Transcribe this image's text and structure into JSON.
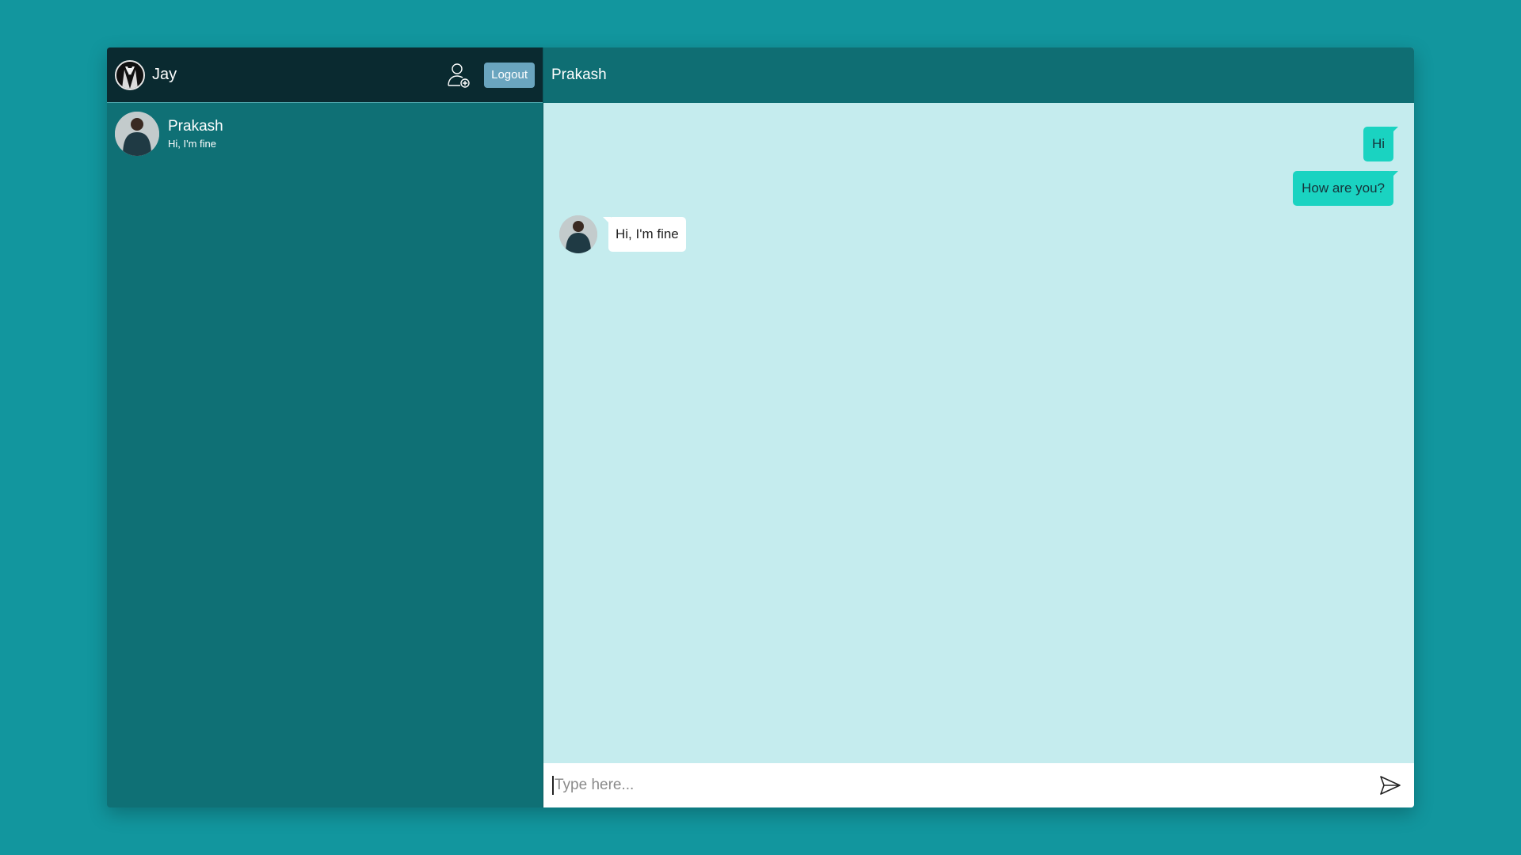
{
  "sidebar": {
    "user": {
      "name": "Jay",
      "avatar_icon": "tuxedo-avatar-icon"
    },
    "add_user_icon": "add-user-icon",
    "logout_label": "Logout",
    "contacts": [
      {
        "name": "Prakash",
        "last_message": "Hi, I'm fine"
      }
    ]
  },
  "chat": {
    "title": "Prakash",
    "messages": [
      {
        "direction": "out",
        "text": "Hi"
      },
      {
        "direction": "out",
        "text": "How are you?"
      },
      {
        "direction": "in",
        "text": "Hi, I'm fine"
      }
    ],
    "composer": {
      "placeholder": "Type here...",
      "value": ""
    },
    "send_icon": "send-icon"
  },
  "colors": {
    "background": "#12969e",
    "sidebar": "#0f7075",
    "sidebar_header": "#0a2a30",
    "chat_header": "#0f6e73",
    "chat_body": "#c5ecee",
    "outgoing_bubble": "#1ad3c1",
    "incoming_bubble": "#ffffff",
    "logout_button": "#6aa5bf"
  }
}
